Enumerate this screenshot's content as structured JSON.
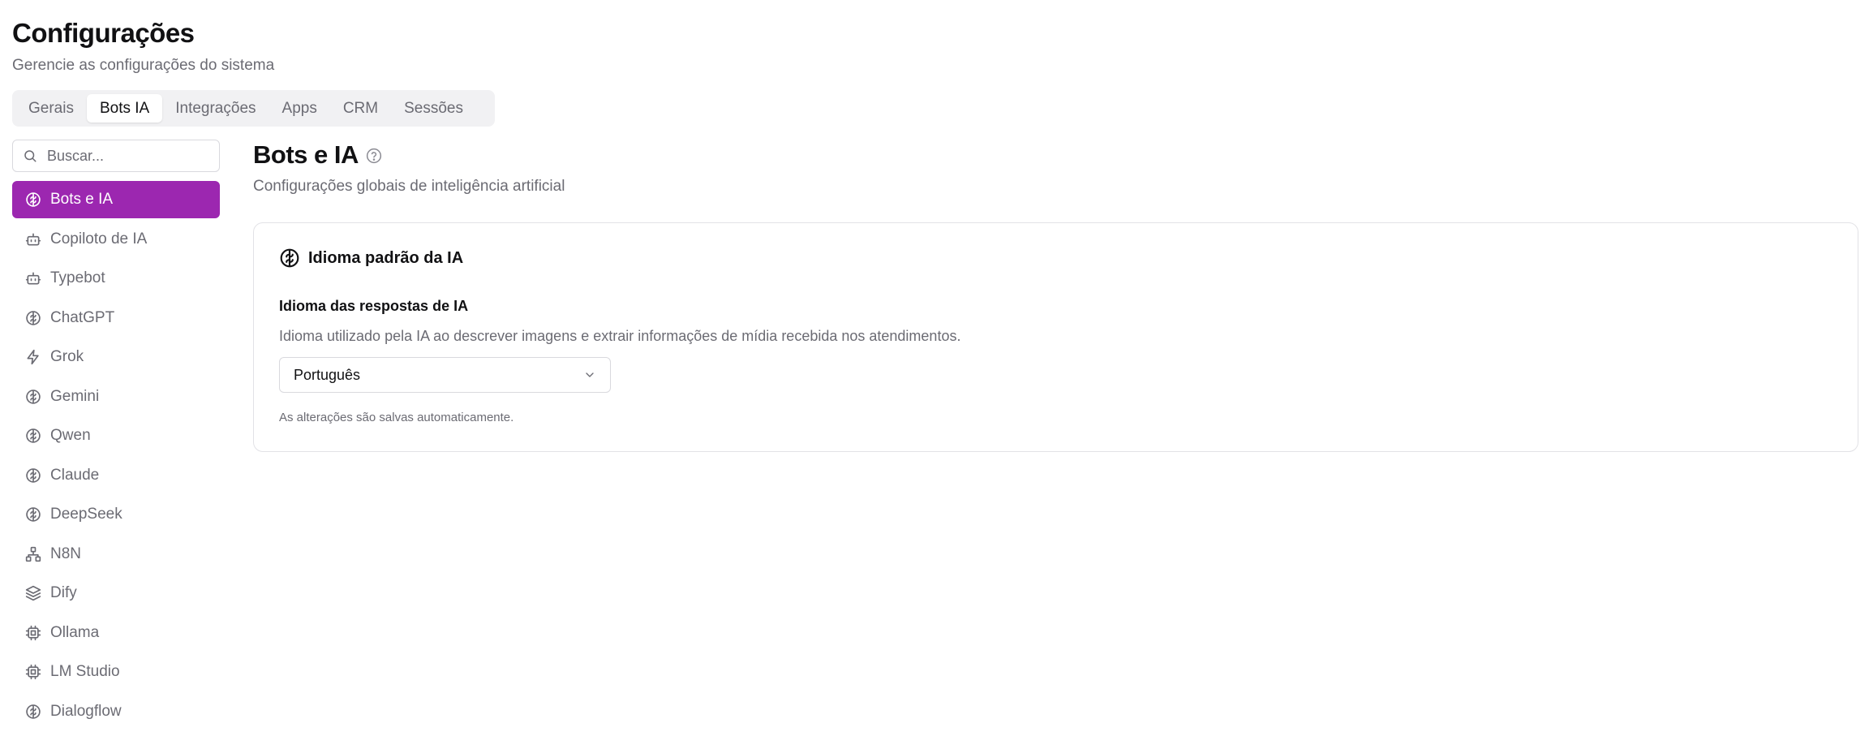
{
  "page": {
    "title": "Configurações",
    "subtitle": "Gerencie as configurações do sistema"
  },
  "tabs": [
    {
      "label": "Gerais",
      "active": false
    },
    {
      "label": "Bots IA",
      "active": true
    },
    {
      "label": "Integrações",
      "active": false
    },
    {
      "label": "Apps",
      "active": false
    },
    {
      "label": "CRM",
      "active": false
    },
    {
      "label": "Sessões",
      "active": false
    }
  ],
  "sidebar": {
    "search_placeholder": "Buscar...",
    "items": [
      {
        "label": "Bots e IA",
        "icon": "brain-icon",
        "active": true
      },
      {
        "label": "Copiloto de IA",
        "icon": "bot-icon",
        "active": false
      },
      {
        "label": "Typebot",
        "icon": "bot-icon",
        "active": false
      },
      {
        "label": "ChatGPT",
        "icon": "brain-icon",
        "active": false
      },
      {
        "label": "Grok",
        "icon": "zap-icon",
        "active": false
      },
      {
        "label": "Gemini",
        "icon": "brain-icon",
        "active": false
      },
      {
        "label": "Qwen",
        "icon": "brain-icon",
        "active": false
      },
      {
        "label": "Claude",
        "icon": "brain-icon",
        "active": false
      },
      {
        "label": "DeepSeek",
        "icon": "brain-icon",
        "active": false
      },
      {
        "label": "N8N",
        "icon": "network-icon",
        "active": false
      },
      {
        "label": "Dify",
        "icon": "layers-icon",
        "active": false
      },
      {
        "label": "Ollama",
        "icon": "cpu-icon",
        "active": false
      },
      {
        "label": "LM Studio",
        "icon": "cpu-icon",
        "active": false
      },
      {
        "label": "Dialogflow",
        "icon": "brain-icon",
        "active": false
      }
    ]
  },
  "content": {
    "title": "Bots e IA",
    "subtitle": "Configurações globais de inteligência artificial",
    "card": {
      "title": "Idioma padrão da IA",
      "icon": "brain-icon",
      "field_label": "Idioma das respostas de IA",
      "field_description": "Idioma utilizado pela IA ao descrever imagens e extrair informações de mídia recebida nos atendimentos.",
      "select_value": "Português",
      "hint": "As alterações são salvas automaticamente."
    }
  },
  "colors": {
    "accent": "#9c27b0",
    "muted_text": "#6b6b73",
    "border": "#e2e2e6"
  }
}
